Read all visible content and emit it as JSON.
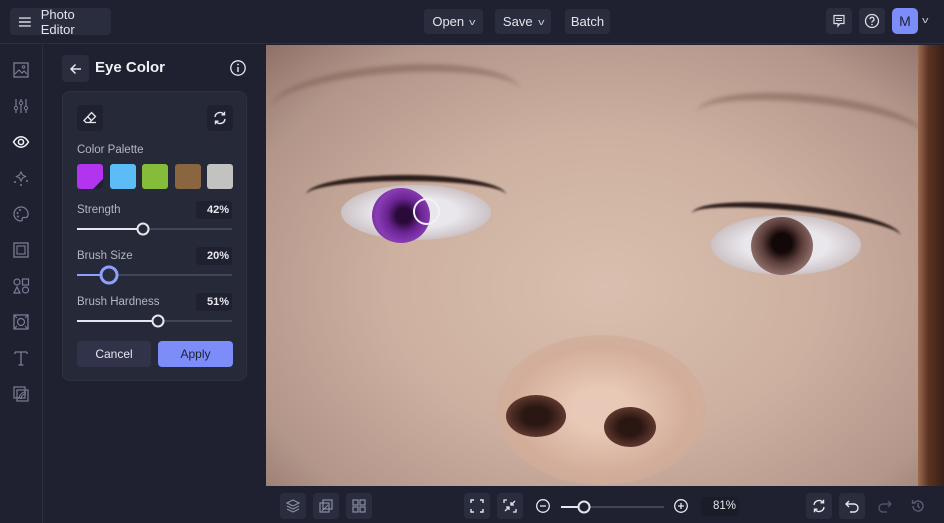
{
  "app": {
    "title": "Photo Editor",
    "menu_icon": "hamburger-icon"
  },
  "toolbar": {
    "open_label": "Open",
    "save_label": "Save",
    "batch_label": "Batch",
    "feedback_icon": "feedback-icon",
    "help_icon": "help-icon",
    "avatar_initial": "M",
    "accent_color": "#7c8cf8"
  },
  "sidebar": {
    "items": [
      {
        "name": "image",
        "icon": "image-icon",
        "active": false
      },
      {
        "name": "adjust",
        "icon": "sliders-icon",
        "active": false
      },
      {
        "name": "touch-up",
        "icon": "eye-icon",
        "active": true
      },
      {
        "name": "effects",
        "icon": "sparkle-icon",
        "active": false
      },
      {
        "name": "artsy",
        "icon": "palette-icon",
        "active": false
      },
      {
        "name": "frames",
        "icon": "frame-icon",
        "active": false
      },
      {
        "name": "graphics",
        "icon": "shapes-icon",
        "active": false
      },
      {
        "name": "overlays",
        "icon": "overlay-icon",
        "active": false
      },
      {
        "name": "text",
        "icon": "text-icon",
        "active": false
      },
      {
        "name": "textures",
        "icon": "texture-icon",
        "active": false
      }
    ]
  },
  "panel": {
    "title": "Eye Color",
    "color_palette_label": "Color Palette",
    "swatches": [
      {
        "color": "#b334ef",
        "selected": true
      },
      {
        "color": "#5bbcf6",
        "selected": false
      },
      {
        "color": "#85bd3a",
        "selected": false
      },
      {
        "color": "#8a6640",
        "selected": false
      },
      {
        "color": "#c2c3c0",
        "selected": false
      }
    ],
    "sliders": [
      {
        "label": "Strength",
        "value": 42,
        "display": "42%"
      },
      {
        "label": "Brush Size",
        "value": 20,
        "display": "20%"
      },
      {
        "label": "Brush Hardness",
        "value": 51,
        "display": "51%"
      }
    ],
    "cancel_label": "Cancel",
    "apply_label": "Apply"
  },
  "bottom": {
    "zoom_value": 81,
    "zoom_display": "81%",
    "zoom_fraction": 0.22
  }
}
